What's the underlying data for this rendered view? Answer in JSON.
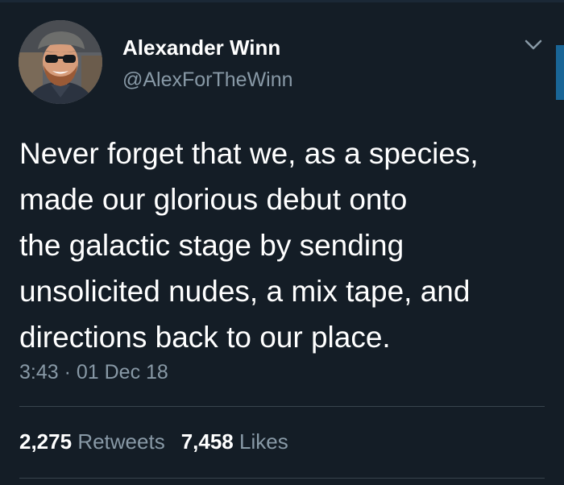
{
  "author": {
    "display_name": "Alexander Winn",
    "handle": "@AlexForTheWinn",
    "avatar_icon": "profile-photo"
  },
  "tweet": {
    "lines": [
      "Never forget that we, as a species,",
      "made our glorious debut onto",
      "the galactic stage by sending",
      "unsolicited nudes, a mix tape, and",
      "directions back to our place."
    ],
    "timestamp": "3:43 · 01 Dec 18"
  },
  "stats": {
    "retweets_count": "2,275",
    "retweets_label": "Retweets",
    "likes_count": "7,458",
    "likes_label": "Likes"
  },
  "icons": {
    "menu": "chevron-down-icon"
  },
  "colors": {
    "background": "#141d26",
    "text_primary": "#ffffff",
    "text_secondary": "#8899a6",
    "divider": "#38444d",
    "accent": "#1da1f2"
  }
}
